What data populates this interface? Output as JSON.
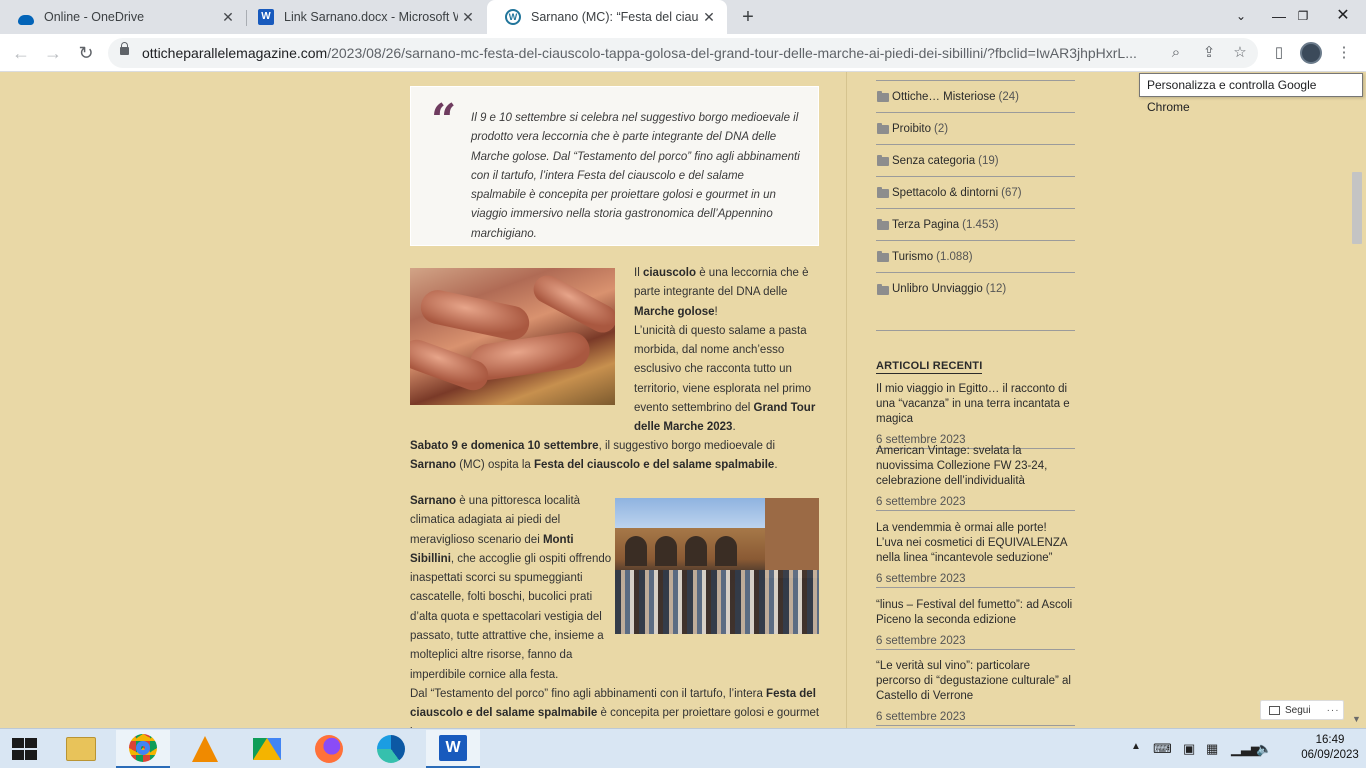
{
  "browser": {
    "tabs": [
      {
        "title": "Online - OneDrive",
        "icon": "onedrive-icon",
        "active": false
      },
      {
        "title": "Link Sarnano.docx - Microsoft W",
        "icon": "word-icon",
        "active": false
      },
      {
        "title": "Sarnano (MC): “Festa del ciauscol",
        "icon": "wordpress-icon",
        "active": true
      }
    ],
    "new_tab_label": "+",
    "url_host": "otticheparallelemagazine.com",
    "url_path": "/2023/08/26/sarnano-mc-festa-del-ciauscolo-tappa-golosa-del-grand-tour-delle-marche-ai-piedi-dei-sibillini/?fbclid=IwAR3jhpHxrL...",
    "tooltip": "Personalizza e controlla Google Chrome"
  },
  "article": {
    "quote": "Il 9 e 10 settembre si celebra nel suggestivo borgo medioevale il prodotto vera leccornia che è parte integrante del DNA delle Marche golose. Dal “Testamento del porco” fino agli abbinamenti con il tartufo, l’intera Festa del ciauscolo e del salame spalmabile è concepita per proiettare golosi e gourmet in un viaggio immersivo nella storia gastronomica dell’Appennino marchigiano.",
    "p1_a": "Il ",
    "p1_b": "ciauscolo",
    "p1_c": " è una leccornia che è parte integrante del DNA delle ",
    "p1_d": "Marche golose",
    "p1_e": "!",
    "p2_a": "L’unicità di questo salame a pasta morbida, dal nome anch’esso esclusivo che racconta tutto un territorio, viene esplorata nel primo evento settembrino del ",
    "p2_b": "Grand Tour delle Marche 2023",
    "p2_c": ".",
    "p3_a": "Sabato 9 e domenica 10 settembre",
    "p3_b": ", il suggestivo borgo medioevale di ",
    "p3_c": "Sarnano",
    "p3_d": " (MC) ospita la ",
    "p3_e": "Festa del ciauscolo e del salame spalmabile",
    "p3_f": ".",
    "p4_a": "Sarnano",
    "p4_b": " è una pittoresca località climatica adagiata ai piedi del meraviglioso scenario dei ",
    "p4_c": "Monti Sibillini",
    "p4_d": ", che accoglie gli ospiti offrendo inaspettati scorci su spumeggianti cascatelle, folti boschi, bucolici prati d’alta quota e spettacolari vestigia del passato, tutte attrattive che, insieme a molteplici altre risorse, fanno da imperdibile cornice alla festa.",
    "p5_a": "Dal “Testamento del porco” fino agli abbinamenti con il tartufo, l’intera ",
    "p5_b": "Festa del ciauscolo e del salame spalmabile",
    "p5_c": " è concepita per proiettare golosi e gourmet in"
  },
  "sidebar": {
    "categories": [
      {
        "name": "Ottiche… Misteriose",
        "count": "(24)"
      },
      {
        "name": "Proibito",
        "count": "(2)"
      },
      {
        "name": "Senza categoria",
        "count": "(19)"
      },
      {
        "name": "Spettacolo & dintorni",
        "count": "(67)"
      },
      {
        "name": "Terza Pagina",
        "count": "(1.453)"
      },
      {
        "name": "Turismo",
        "count": "(1.088)"
      },
      {
        "name": "Unlibro Unviaggio",
        "count": "(12)"
      }
    ],
    "recent_title": "ARTICOLI RECENTI",
    "recent": [
      {
        "title": "Il mio viaggio in Egitto… il racconto di una “vacanza” in una terra incantata e magica",
        "date": "6 settembre 2023"
      },
      {
        "title": "American Vintage: svelata la nuovissima Collezione FW 23-24, celebrazione dell’individualità",
        "date": "6 settembre 2023"
      },
      {
        "title": "La vendemmia è ormai alle porte! L’uva nei cosmetici di EQUIVALENZA nella linea “incantevole seduzione”",
        "date": "6 settembre 2023"
      },
      {
        "title": "“linus – Festival del fumetto”: ad Ascoli Piceno la seconda edizione",
        "date": "6 settembre 2023"
      },
      {
        "title": "“Le verità sul vino”: particolare percorso di “degustazione culturale” al Castello di Verrone",
        "date": "6 settembre 2023"
      }
    ],
    "follow_label": "Segui",
    "follow_more": "···"
  },
  "taskbar": {
    "time": "16:49",
    "date": "06/09/2023"
  }
}
